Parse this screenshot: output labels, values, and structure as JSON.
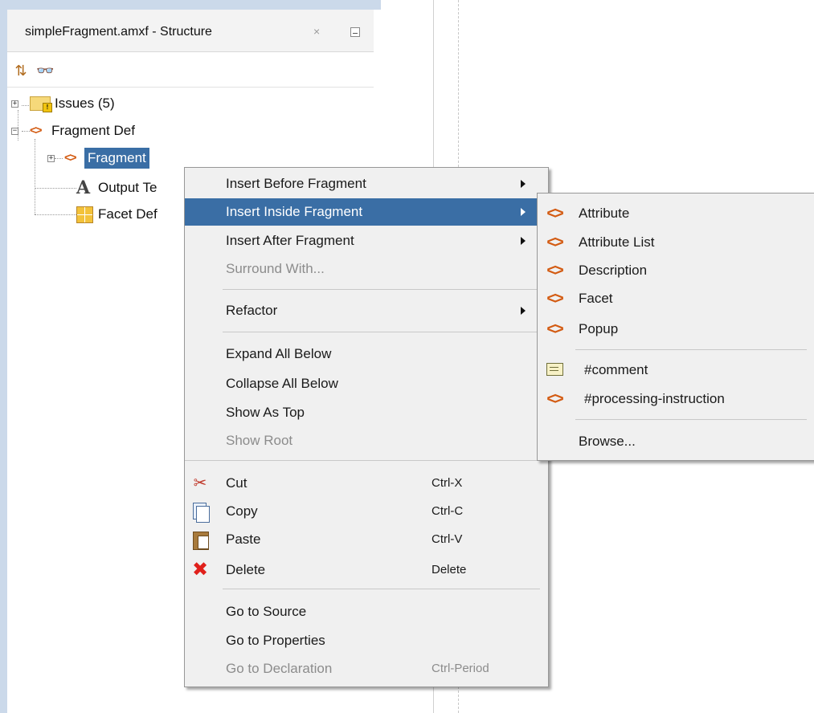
{
  "panel": {
    "tab_title": "simpleFragment.amxf - Structure",
    "close_glyph": "×",
    "toolbar": [
      {
        "icon": "synchronize-icon",
        "glyph": "⇅"
      },
      {
        "icon": "find-binoculars-icon",
        "glyph": "👓"
      }
    ],
    "tree": [
      {
        "label": "Issues (5)",
        "icon": "folder-warning-icon",
        "expander": "+"
      },
      {
        "label": "Fragment Def",
        "icon": "xml-element-icon",
        "expander": "−"
      },
      {
        "label": "Fragment",
        "icon": "xml-element-icon",
        "expander": "+",
        "selected": true
      },
      {
        "label": "Output Te",
        "icon": "output-text-icon"
      },
      {
        "label": "Facet Def",
        "icon": "facet-def-icon"
      }
    ]
  },
  "context_menu": {
    "items": [
      {
        "label": "Insert Before Fragment",
        "submenu": true
      },
      {
        "label": "Insert Inside Fragment",
        "submenu": true,
        "highlighted": true
      },
      {
        "label": "Insert After Fragment",
        "submenu": true
      },
      {
        "label": "Surround With...",
        "disabled": true
      },
      {
        "label": "Refactor",
        "submenu": true
      },
      {
        "label": "Expand All Below"
      },
      {
        "label": "Collapse All Below"
      },
      {
        "label": "Show As Top"
      },
      {
        "label": "Show Root",
        "disabled": true
      },
      {
        "label": "Cut",
        "shortcut": "Ctrl-X",
        "icon": "scissors-icon"
      },
      {
        "label": "Copy",
        "shortcut": "Ctrl-C",
        "icon": "copy-icon"
      },
      {
        "label": "Paste",
        "shortcut": "Ctrl-V",
        "icon": "paste-icon"
      },
      {
        "label": "Delete",
        "shortcut": "Delete",
        "icon": "delete-icon"
      },
      {
        "label": "Go to Source"
      },
      {
        "label": "Go to Properties"
      },
      {
        "label": "Go to Declaration",
        "shortcut": "Ctrl-Period",
        "disabled": true
      }
    ]
  },
  "submenu": {
    "items": [
      {
        "label": "Attribute",
        "icon": "xml-element-icon"
      },
      {
        "label": "Attribute List",
        "icon": "xml-element-icon"
      },
      {
        "label": "Description",
        "icon": "xml-element-icon"
      },
      {
        "label": "Facet",
        "icon": "xml-element-icon"
      },
      {
        "label": "Popup",
        "icon": "xml-element-icon"
      },
      {
        "label": "#comment",
        "icon": "comment-icon"
      },
      {
        "label": "#processing-instruction",
        "icon": "xml-element-icon"
      },
      {
        "label": "Browse..."
      }
    ]
  },
  "colors": {
    "selection": "#3a6ea5",
    "xml_icon": "#d35b12",
    "panel_border": "#cbd9ea",
    "menu_bg": "#f0f0f0"
  }
}
